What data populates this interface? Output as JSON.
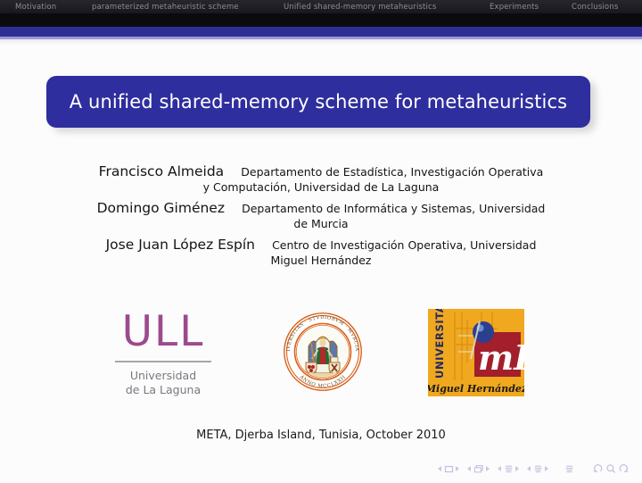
{
  "navbar": {
    "items": [
      {
        "label": "Motivation"
      },
      {
        "label": "parameterized metaheuristic scheme"
      },
      {
        "label": "Unified shared-memory metaheuristics"
      },
      {
        "label": "Experiments"
      },
      {
        "label": "Conclusions"
      }
    ]
  },
  "title": {
    "text": "A unified shared-memory scheme for metaheuristics",
    "box_color": "#2e2e9e",
    "text_color": "#ffffff"
  },
  "authors": [
    {
      "name": "Francisco Almeida",
      "affiliation_line1": "Departamento de Estadística, Investigación Operativa",
      "affiliation_line2": "y Computación, Universidad de La Laguna"
    },
    {
      "name": "Domingo Giménez",
      "affiliation_line1": "Departamento de Informática y Sistemas, Universidad",
      "affiliation_line2": "de Murcia"
    },
    {
      "name": "Jose Juan López Espín",
      "affiliation_line1": "Centro de Investigación Operativa, Universidad",
      "affiliation_line2": "Miguel Hernández"
    }
  ],
  "logos": {
    "ull": {
      "mark": "ULL",
      "line1": "Universidad",
      "line2": "de La Laguna",
      "mark_color": "#9c4a8e",
      "text_color": "#767a80"
    },
    "murcia": {
      "ring_text_top": "VNIVERSITAS · STVDIORVM · MVRCIANA",
      "ring_text_bottom": "ANNO MCCLXXII",
      "ring_color": "#e0651c"
    },
    "umh": {
      "vertical_text": "UNIVERSITAS",
      "monogram": "mH",
      "caption": "Miguel Hernández",
      "background_color": "#f0a81e",
      "square_color": "#a31f2c",
      "sphere_color": "#2b3f8f"
    }
  },
  "footer": {
    "venue": "META, Djerba Island, Tunisia, October 2010"
  },
  "nav_symbols": {
    "slide": "slide-navigation",
    "frame": "frame-navigation",
    "subsection": "subsection-navigation",
    "section": "section-navigation",
    "document": "document-navigation",
    "back": "back-navigation",
    "search": "search-navigation",
    "forward": "forward-navigation"
  }
}
